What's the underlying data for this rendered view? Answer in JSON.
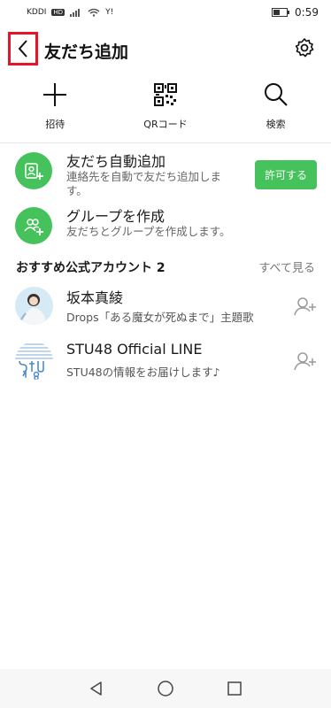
{
  "status": {
    "carrier": "KDDI",
    "hd": "HD",
    "carrier2": "Y!",
    "time": "0:59"
  },
  "header": {
    "title": "友だち追加"
  },
  "actions": [
    {
      "label": "招待",
      "icon": "plus-icon"
    },
    {
      "label": "QRコード",
      "icon": "qr-code-icon"
    },
    {
      "label": "検索",
      "icon": "search-icon"
    }
  ],
  "auto_add": {
    "title": "友だち自動追加",
    "subtitle_line1": "連絡先を自動で友だち追加しま",
    "subtitle_line2": "す。",
    "button": "許可する"
  },
  "create_group": {
    "title": "グループを作成",
    "subtitle": "友だちとグループを作成します。"
  },
  "recommended": {
    "title": "おすすめ公式アカウント 2",
    "see_all": "すべて見る",
    "accounts": [
      {
        "name": "坂本真綾",
        "desc": "Drops「ある魔女が死ぬまで」主題歌"
      },
      {
        "name": "STU48 Official LINE",
        "desc": "STU48の情報をお届けします♪"
      }
    ]
  },
  "colors": {
    "accent": "#46c25c",
    "highlight_box": "#e8122a"
  }
}
